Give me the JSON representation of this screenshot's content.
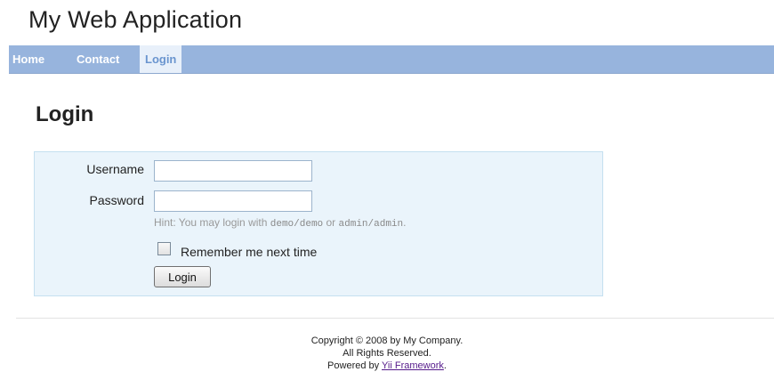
{
  "app": {
    "title": "My Web Application"
  },
  "nav": {
    "items": [
      {
        "label": "Home",
        "active": false
      },
      {
        "label": "Contact",
        "active": false
      },
      {
        "label": "Login",
        "active": true
      }
    ]
  },
  "page": {
    "title": "Login"
  },
  "form": {
    "username_label": "Username",
    "username_value": "",
    "password_label": "Password",
    "password_value": "",
    "hint_prefix": "Hint: You may login with ",
    "hint_demo": "demo/demo",
    "hint_or": " or ",
    "hint_admin": "admin/admin",
    "hint_suffix": ".",
    "remember_label": "Remember me next time",
    "remember_checked": false,
    "submit_label": "Login"
  },
  "footer": {
    "copyright": "Copyright © 2008 by My Company.",
    "rights": "All Rights Reserved.",
    "powered_prefix": "Powered by ",
    "powered_link": "Yii Framework",
    "powered_suffix": "."
  },
  "colors": {
    "nav_background": "#97b4dd",
    "nav_active_background": "#e8f0fa",
    "nav_active_text": "#6a95cf",
    "form_background": "#eaf4fb",
    "form_border": "#c5e0f0",
    "link": "#551a8b"
  }
}
